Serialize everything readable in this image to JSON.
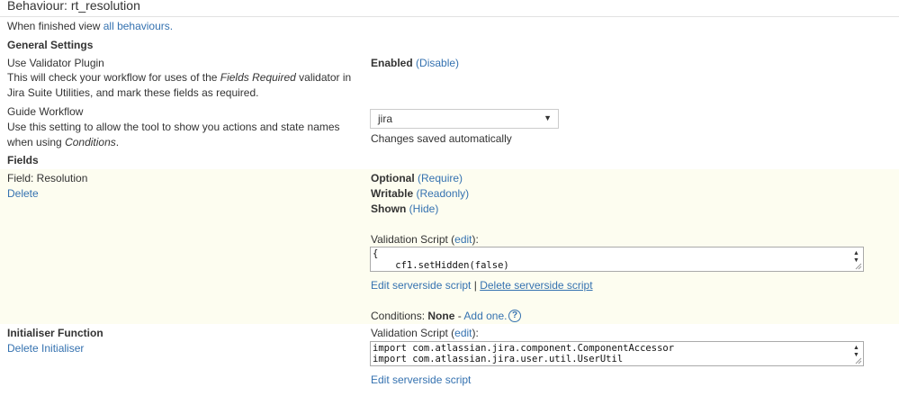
{
  "header": {
    "title": "Behaviour: rt_resolution",
    "finished_prefix": "When finished view",
    "finished_link": "all behaviours."
  },
  "general": {
    "heading": "General Settings",
    "validator": {
      "label": "Use Validator Plugin",
      "desc_1": "This will check your workflow for uses of the",
      "desc_italic": "Fields Required",
      "desc_2": "validator in Jira",
      "desc_3": "Suite Utilities, and mark these fields as required.",
      "status": "Enabled",
      "action": "(Disable)"
    },
    "guide": {
      "label": "Guide Workflow",
      "desc_1": "Use this setting to allow the tool to show you actions and state names when",
      "desc_2": "using",
      "desc_italic": "Conditions",
      "desc_end": ".",
      "select_value": "jira",
      "saved_note": "Changes saved automatically"
    }
  },
  "fields": {
    "heading": "Fields",
    "field_label": "Field: Resolution",
    "delete_link": "Delete",
    "optional": "Optional",
    "require_link": "(Require)",
    "writable": "Writable",
    "readonly_link": "(Readonly)",
    "shown": "Shown",
    "hide_link": "(Hide)",
    "script_label": "Validation Script",
    "edit_link": "edit",
    "script_lines": [
      "{",
      "    cf1.setHidden(false)"
    ],
    "edit_serverside": "Edit serverside script",
    "separator": "|",
    "delete_serverside": "Delete serverside script",
    "conditions_label": "Conditions:",
    "conditions_value": "None",
    "conditions_dash": "-",
    "add_one": "Add one."
  },
  "initialiser": {
    "heading": "Initialiser Function",
    "delete_link": "Delete Initialiser",
    "script_label": "Validation Script",
    "edit_link": "edit",
    "script_lines": [
      "import com.atlassian.jira.component.ComponentAccessor",
      "import com.atlassian.jira.user.util.UserUtil"
    ],
    "edit_serverside": "Edit serverside script"
  },
  "colors": {
    "link": "#3572b0",
    "fields_background": "#fdfdf0",
    "text": "#333333"
  }
}
